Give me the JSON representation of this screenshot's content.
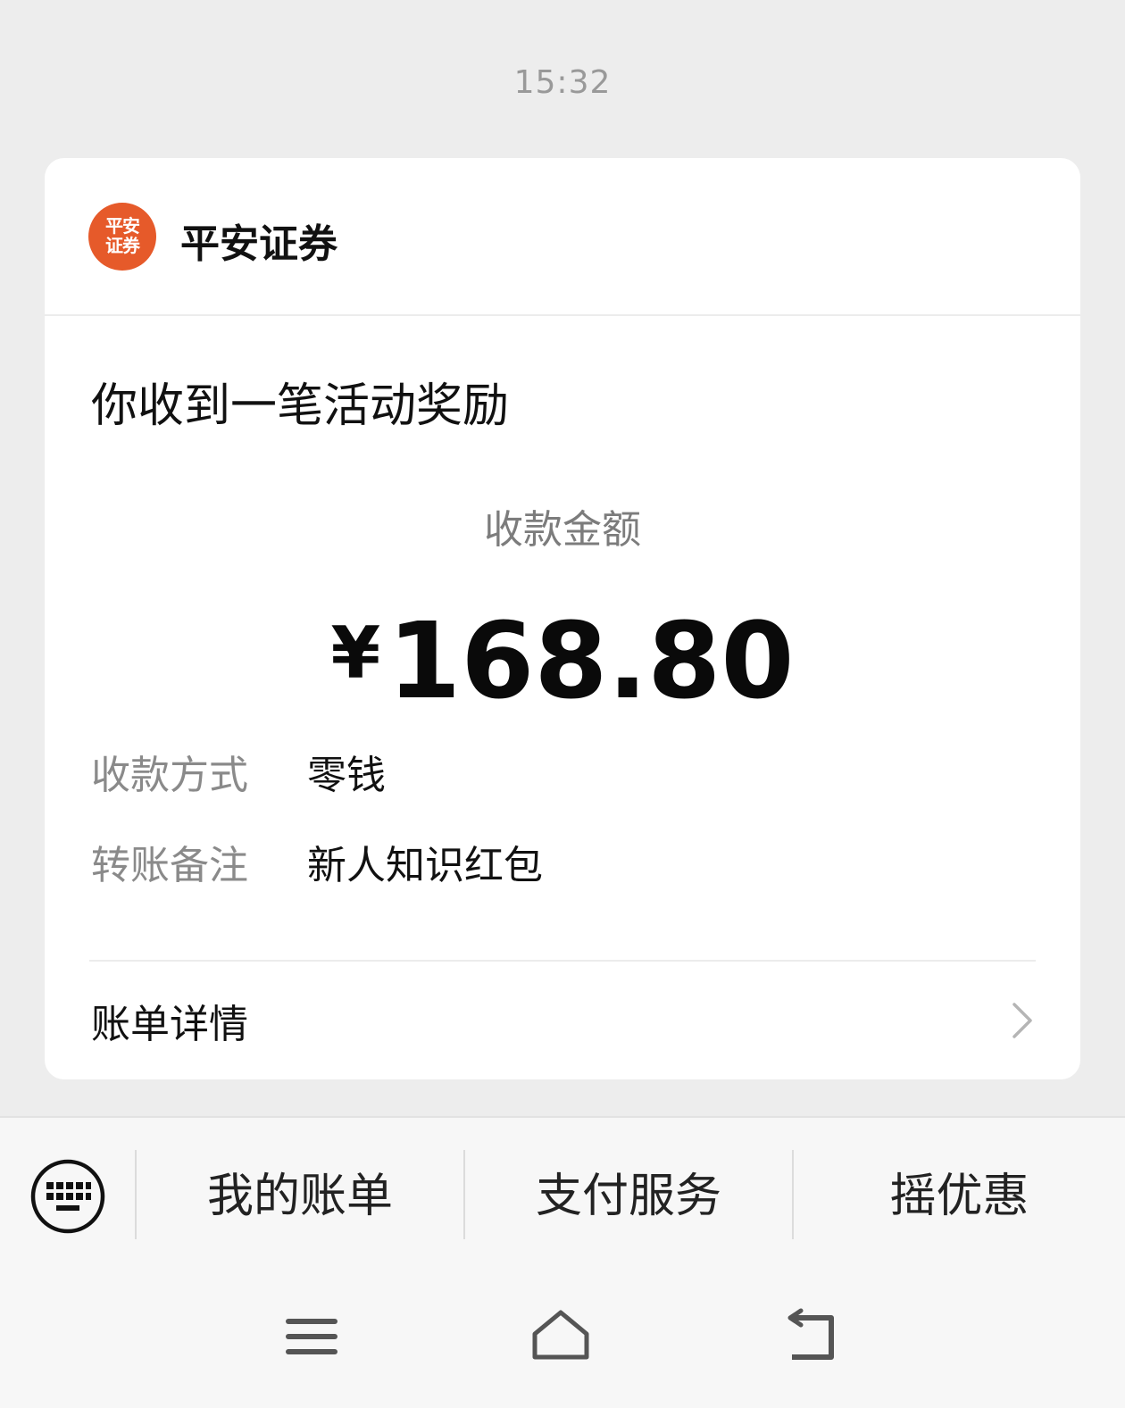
{
  "timestamp": "15:32",
  "card": {
    "sender": {
      "logo_line1": "平安",
      "logo_line2": "证券",
      "name": "平安证券"
    },
    "title": "你收到一笔活动奖励",
    "amount_label": "收款金额",
    "currency_symbol": "¥",
    "amount": "168.80",
    "info": [
      {
        "label": "收款方式",
        "value": "零钱"
      },
      {
        "label": "转账备注",
        "value": "新人知识红包"
      }
    ],
    "detail_link": "账单详情"
  },
  "bottom_menu": {
    "items": [
      {
        "label": "我的账单"
      },
      {
        "label": "支付服务"
      },
      {
        "label": "摇优惠"
      }
    ]
  },
  "icons": {
    "keyboard": "keyboard-icon",
    "chevron": "chevron-right-icon",
    "nav_menu": "menu-icon",
    "nav_home": "home-icon",
    "nav_back": "back-icon"
  },
  "colors": {
    "background": "#ededed",
    "card": "#ffffff",
    "logo": "#e65a2a",
    "secondary_text": "#8a8a8a"
  }
}
